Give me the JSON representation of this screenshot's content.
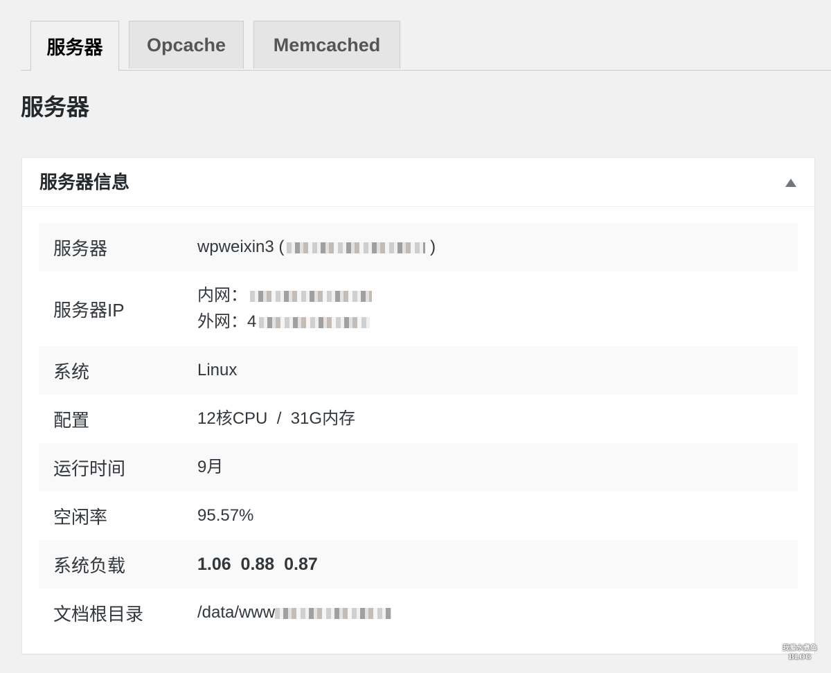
{
  "tabs": [
    {
      "label": "服务器",
      "active": true
    },
    {
      "label": "Opcache",
      "active": false
    },
    {
      "label": "Memcached",
      "active": false
    }
  ],
  "page_title": "服务器",
  "postbox": {
    "title": "服务器信息",
    "toggle_icon": "triangle-up-icon"
  },
  "rows": {
    "server": {
      "label": "服务器",
      "value": "wpweixin3 (",
      "value_end": ")"
    },
    "server_ip": {
      "label": "服务器IP",
      "inner_prefix": "内网：",
      "outer_prefix": "外网：4"
    },
    "os": {
      "label": "系统",
      "value": "Linux"
    },
    "config": {
      "label": "配置",
      "value": "12核CPU  /  31G内存"
    },
    "uptime": {
      "label": "运行时间",
      "value": "9月"
    },
    "idle": {
      "label": "空闲率",
      "value": "95.57%"
    },
    "load": {
      "label": "系统负载",
      "value": "1.06  0.88  0.87"
    },
    "docroot": {
      "label": "文档根目录",
      "value": "/data/www"
    }
  },
  "watermark": {
    "line1": "我爱水煮鱼",
    "line2": "BLOG"
  }
}
